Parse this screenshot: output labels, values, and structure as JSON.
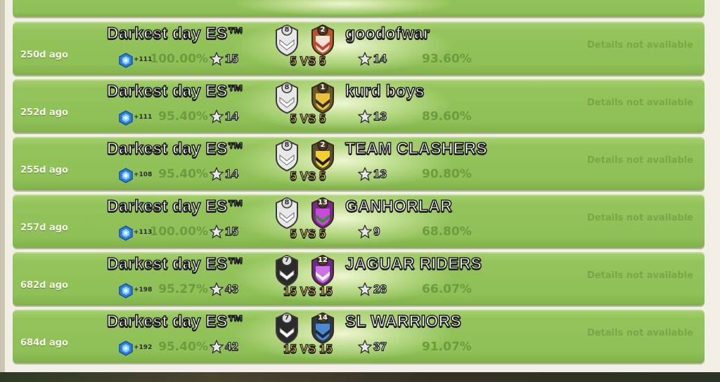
{
  "war_log": {
    "rows": [
      {
        "ago": "250d ago",
        "clan_name": "Darkest day ES™",
        "clan_xp": "+111",
        "clan_percent": "100.00%",
        "clan_stars": "15",
        "clan_badge_level": "8",
        "size_label": "5 VS 5",
        "opponent_name": "goodofwar",
        "opponent_badge_level": "2",
        "opponent_stars": "14",
        "opponent_percent": "93.60%",
        "details": "Details not available",
        "opponent_badge_colors": [
          "#b8552c",
          "#f0e6d6",
          "#d43c2c"
        ]
      },
      {
        "ago": "252d ago",
        "clan_name": "Darkest day ES™",
        "clan_xp": "+111",
        "clan_percent": "95.40%",
        "clan_stars": "14",
        "clan_badge_level": "8",
        "size_label": "5 VS 5",
        "opponent_name": "kurd boys",
        "opponent_badge_level": "1",
        "opponent_stars": "13",
        "opponent_percent": "89.60%",
        "details": "Details not available",
        "opponent_badge_colors": [
          "#6b5a2c",
          "#e8c23a",
          "#3a3020"
        ]
      },
      {
        "ago": "255d ago",
        "clan_name": "Darkest day ES™",
        "clan_xp": "+108",
        "clan_percent": "95.40%",
        "clan_stars": "14",
        "clan_badge_level": "8",
        "size_label": "5 VS 5",
        "opponent_name": "TEAM CLASHERS",
        "opponent_badge_level": "2",
        "opponent_stars": "13",
        "opponent_percent": "90.80%",
        "details": "Details not available",
        "opponent_badge_colors": [
          "#5a5030",
          "#f2d030",
          "#1e1e1e"
        ]
      },
      {
        "ago": "257d ago",
        "clan_name": "Darkest day ES™",
        "clan_xp": "+113",
        "clan_percent": "100.00%",
        "clan_stars": "15",
        "clan_badge_level": "8",
        "size_label": "5 VS 5",
        "opponent_name": "GANHORLAR",
        "opponent_badge_level": "13",
        "opponent_stars": "9",
        "opponent_percent": "68.80%",
        "details": "Details not available",
        "opponent_badge_colors": [
          "#7a2a8c",
          "#c84ad8",
          "#3a8a3a"
        ]
      },
      {
        "ago": "682d ago",
        "clan_name": "Darkest day ES™",
        "clan_xp": "+198",
        "clan_percent": "95.27%",
        "clan_stars": "43",
        "clan_badge_level": "7",
        "size_label": "15 VS 15",
        "opponent_name": "JAGUAR RIDERS",
        "opponent_badge_level": "12",
        "opponent_stars": "28",
        "opponent_percent": "66.07%",
        "details": "Details not available",
        "opponent_badge_colors": [
          "#6a2a8a",
          "#d070e8",
          "#ffffff"
        ]
      },
      {
        "ago": "684d ago",
        "clan_name": "Darkest day ES™",
        "clan_xp": "+192",
        "clan_percent": "95.40%",
        "clan_stars": "42",
        "clan_badge_level": "7",
        "size_label": "15 VS 15",
        "opponent_name": "SL WARRIORS",
        "opponent_badge_level": "14",
        "opponent_stars": "37",
        "opponent_percent": "91.07%",
        "details": "Details not available",
        "opponent_badge_colors": [
          "#2a3a4a",
          "#4a8ad0",
          "#1e2a36"
        ]
      }
    ]
  }
}
